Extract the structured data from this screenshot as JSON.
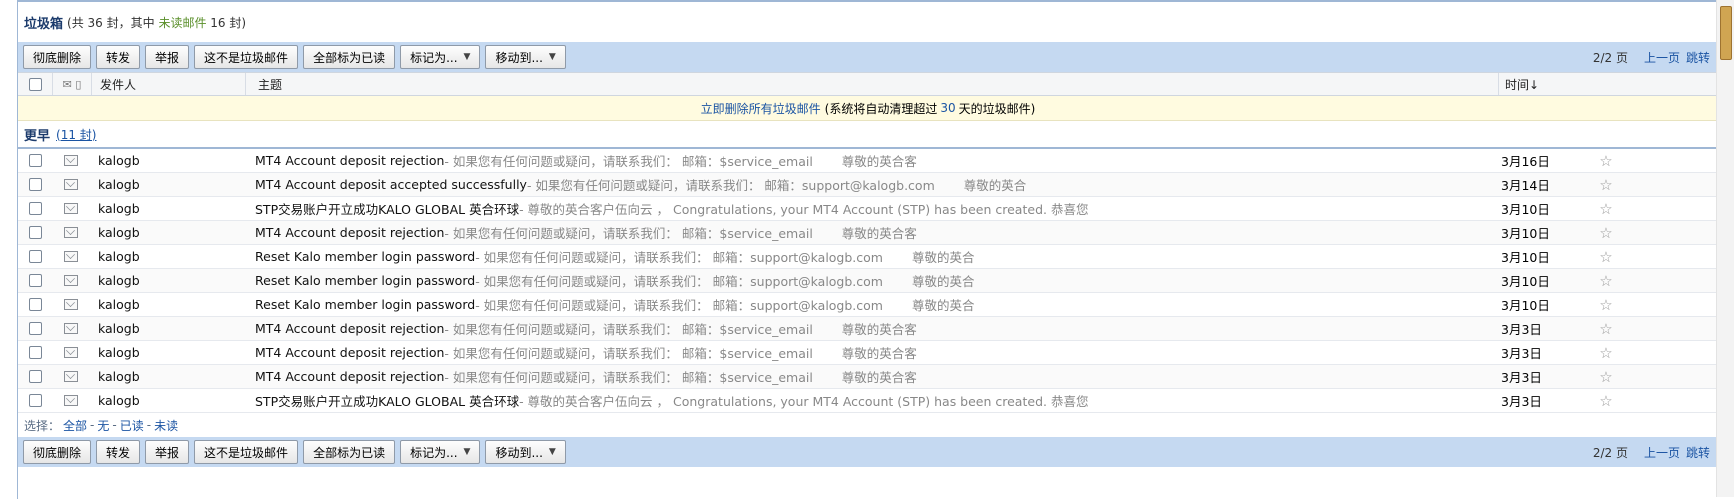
{
  "folder": {
    "title": "垃圾箱",
    "meta_prefix": "(共 36 封，其中",
    "unread_label": "未读邮件",
    "meta_suffix": "16 封)"
  },
  "toolbar": {
    "delete_label": "彻底删除",
    "forward_label": "转发",
    "report_label": "举报",
    "not_spam_label": "这不是垃圾邮件",
    "mark_all_read_label": "全部标为已读",
    "mark_as_label": "标记为...",
    "move_to_label": "移动到...",
    "page_num": "2/2 页",
    "prev_label": "上一页",
    "jump_label": "跳转"
  },
  "columns": {
    "sender": "发件人",
    "subject": "主题",
    "time": "时间↓"
  },
  "notice": {
    "link_text": "立即删除所有垃圾邮件",
    "text_prefix": "(系统将自动清理超过",
    "days": "30",
    "text_suffix": "天的垃圾邮件)"
  },
  "group": {
    "label": "更早",
    "count": "(11 封)"
  },
  "emails": [
    {
      "sender": "kalogb",
      "subject": "MT4 Account deposit rejection",
      "snippet": " - 如果您有任何问题或疑问，请联系我们： 邮箱：$service_email 　　尊敬的英合客",
      "time": "3月16日"
    },
    {
      "sender": "kalogb",
      "subject": "MT4 Account deposit accepted successfully",
      "snippet": " - 如果您有任何问题或疑问，请联系我们： 邮箱：support@kalogb.com 　　尊敬的英合",
      "time": "3月14日"
    },
    {
      "sender": "kalogb",
      "subject": "STP交易账户开立成功KALO GLOBAL 英合环球",
      "snippet": " - 尊敬的英合客户伍向云 ， Congratulations, your MT4 Account (STP) has been created. 恭喜您",
      "time": "3月10日"
    },
    {
      "sender": "kalogb",
      "subject": "MT4 Account deposit rejection",
      "snippet": " - 如果您有任何问题或疑问，请联系我们： 邮箱：$service_email 　　尊敬的英合客",
      "time": "3月10日"
    },
    {
      "sender": "kalogb",
      "subject": "Reset Kalo member login password",
      "snippet": " - 如果您有任何问题或疑问，请联系我们： 邮箱：support@kalogb.com 　　尊敬的英合",
      "time": "3月10日"
    },
    {
      "sender": "kalogb",
      "subject": "Reset Kalo member login password",
      "snippet": " - 如果您有任何问题或疑问，请联系我们： 邮箱：support@kalogb.com 　　尊敬的英合",
      "time": "3月10日"
    },
    {
      "sender": "kalogb",
      "subject": "Reset Kalo member login password",
      "snippet": " - 如果您有任何问题或疑问，请联系我们： 邮箱：support@kalogb.com 　　尊敬的英合",
      "time": "3月10日"
    },
    {
      "sender": "kalogb",
      "subject": "MT4 Account deposit rejection",
      "snippet": " - 如果您有任何问题或疑问，请联系我们： 邮箱：$service_email 　　尊敬的英合客",
      "time": "3月3日"
    },
    {
      "sender": "kalogb",
      "subject": "MT4 Account deposit rejection",
      "snippet": " - 如果您有任何问题或疑问，请联系我们： 邮箱：$service_email 　　尊敬的英合客",
      "time": "3月3日"
    },
    {
      "sender": "kalogb",
      "subject": "MT4 Account deposit rejection",
      "snippet": " - 如果您有任何问题或疑问，请联系我们： 邮箱：$service_email 　　尊敬的英合客",
      "time": "3月3日"
    },
    {
      "sender": "kalogb",
      "subject": "STP交易账户开立成功KALO GLOBAL 英合环球",
      "snippet": " - 尊敬的英合客户伍向云 ， Congratulations, your MT4 Account (STP) has been created. 恭喜您",
      "time": "3月3日"
    }
  ],
  "select_bar": {
    "prefix": "选择：",
    "all": "全部",
    "none": "无",
    "read": "已读",
    "unread": "未读",
    "sep": "-"
  },
  "colors": {
    "toolbar_bg": "#c5d9f1",
    "title_color": "#1c3b6c",
    "link_color": "#1b54a3",
    "unread_color": "#5a8f2a",
    "notice_bg": "#fffbe0"
  },
  "icons": {
    "watermark": "shield-cross-icon",
    "star": "star-icon",
    "envelope": "envelope-icon"
  }
}
